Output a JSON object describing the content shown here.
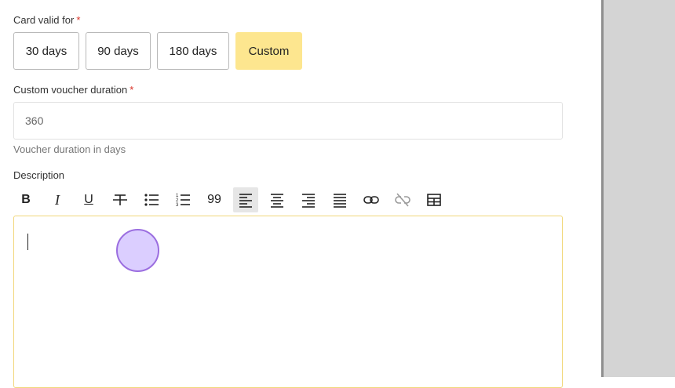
{
  "card_valid": {
    "label": "Card valid for",
    "required_mark": "*",
    "options": [
      "30 days",
      "90 days",
      "180 days",
      "Custom"
    ],
    "selected": "Custom",
    "active_color": "#fde68f"
  },
  "custom_duration": {
    "label": "Custom voucher duration",
    "required_mark": "*",
    "value": "360",
    "help": "Voucher duration in days"
  },
  "description": {
    "label": "Description",
    "toolbar": {
      "bold": "B",
      "italic": "I",
      "underline": "U",
      "blockquote": "99",
      "icons": [
        "bold-icon",
        "italic-icon",
        "underline-icon",
        "strikethrough-icon",
        "bullet-list-icon",
        "numbered-list-icon",
        "blockquote-icon",
        "align-left-icon",
        "align-center-icon",
        "align-right-icon",
        "align-justify-icon",
        "link-icon",
        "unlink-icon",
        "table-icon"
      ],
      "active": "align-left-icon"
    },
    "editor_border_color": "#f1d77a"
  },
  "colors": {
    "side_panel": "#d4d4d4",
    "cursor_indicator": "#9b6ee0"
  }
}
